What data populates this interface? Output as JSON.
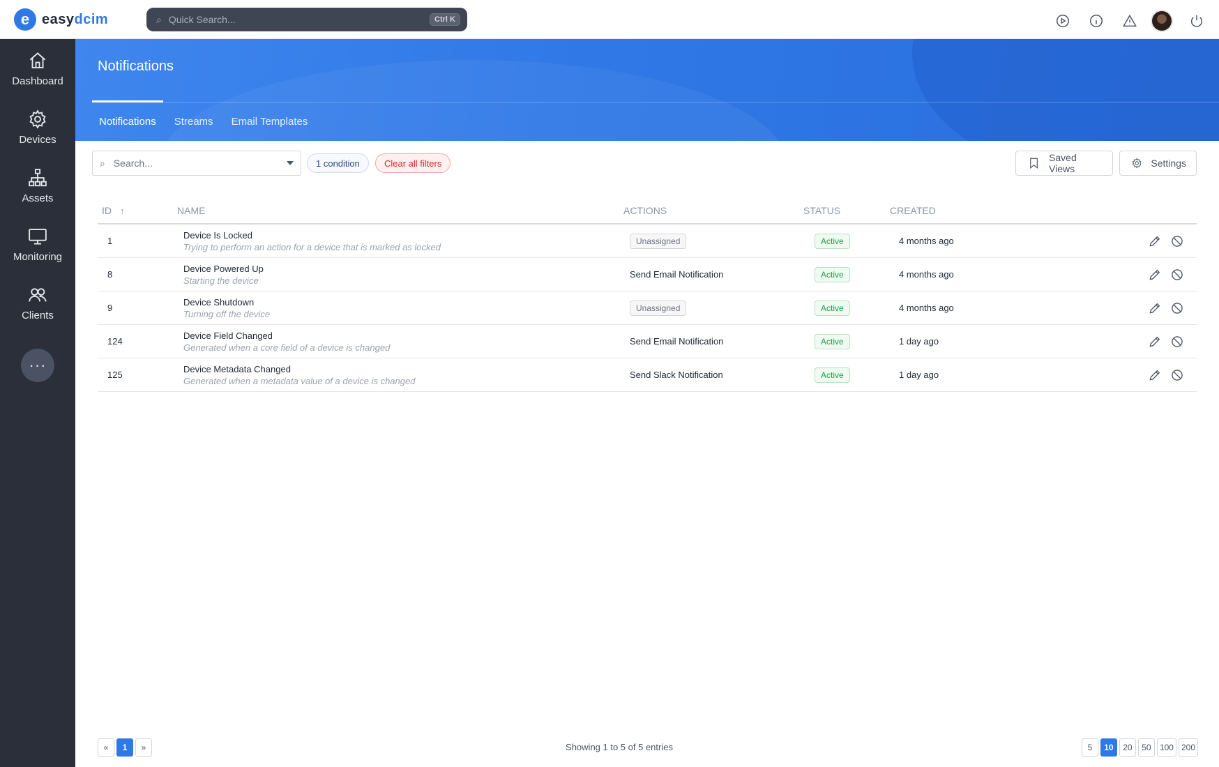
{
  "brand": {
    "mark": "e",
    "name_prefix": "easy",
    "name_accent": "dcim"
  },
  "quick_search": {
    "placeholder": "Quick Search...",
    "shortcut": "Ctrl K"
  },
  "sidebar": {
    "items": [
      {
        "label": "Dashboard",
        "icon": "home-icon"
      },
      {
        "label": "Devices",
        "icon": "gear-icon"
      },
      {
        "label": "Assets",
        "icon": "hierarchy-icon"
      },
      {
        "label": "Monitoring",
        "icon": "monitor-icon"
      },
      {
        "label": "Clients",
        "icon": "users-icon"
      }
    ],
    "more": "···"
  },
  "header": {
    "title": "Notifications",
    "tabs": [
      {
        "label": "Notifications",
        "active": true
      },
      {
        "label": "Streams",
        "active": false
      },
      {
        "label": "Email Templates",
        "active": false
      }
    ]
  },
  "toolbar": {
    "search_placeholder": "Search...",
    "condition_chip": "1 condition",
    "clear_chip": "Clear all filters",
    "saved_views": "Saved Views",
    "settings": "Settings"
  },
  "table": {
    "columns": [
      "ID",
      "NAME",
      "ACTIONS",
      "STATUS",
      "CREATED"
    ],
    "rows": [
      {
        "id": "1",
        "name": "Device Is Locked",
        "desc": "Trying to perform an action for a device that is marked as locked",
        "action": "Unassigned",
        "action_badge": true,
        "status": "Active",
        "created": "4 months ago"
      },
      {
        "id": "8",
        "name": "Device Powered Up",
        "desc": "Starting the device",
        "action": "Send Email Notification",
        "action_badge": false,
        "status": "Active",
        "created": "4 months ago"
      },
      {
        "id": "9",
        "name": "Device Shutdown",
        "desc": "Turning off the device",
        "action": "Unassigned",
        "action_badge": true,
        "status": "Active",
        "created": "4 months ago"
      },
      {
        "id": "124",
        "name": "Device Field Changed",
        "desc": "Generated when a core field of a device is changed",
        "action": "Send Email Notification",
        "action_badge": false,
        "status": "Active",
        "created": "1 day ago"
      },
      {
        "id": "125",
        "name": "Device Metadata Changed",
        "desc": "Generated when a metadata value of a device is changed",
        "action": "Send Slack Notification",
        "action_badge": false,
        "status": "Active",
        "created": "1 day ago"
      }
    ]
  },
  "footer": {
    "prev": "«",
    "page": "1",
    "next": "»",
    "showing": "Showing 1 to 5 of 5 entries",
    "page_sizes": [
      "5",
      "10",
      "20",
      "50",
      "100",
      "200"
    ],
    "active_page_size": "10"
  },
  "colors": {
    "brand_blue": "#2f78e6",
    "sidebar_bg": "#2b2f3a",
    "active_green": "#16a34a",
    "danger_red": "#dc2626"
  }
}
